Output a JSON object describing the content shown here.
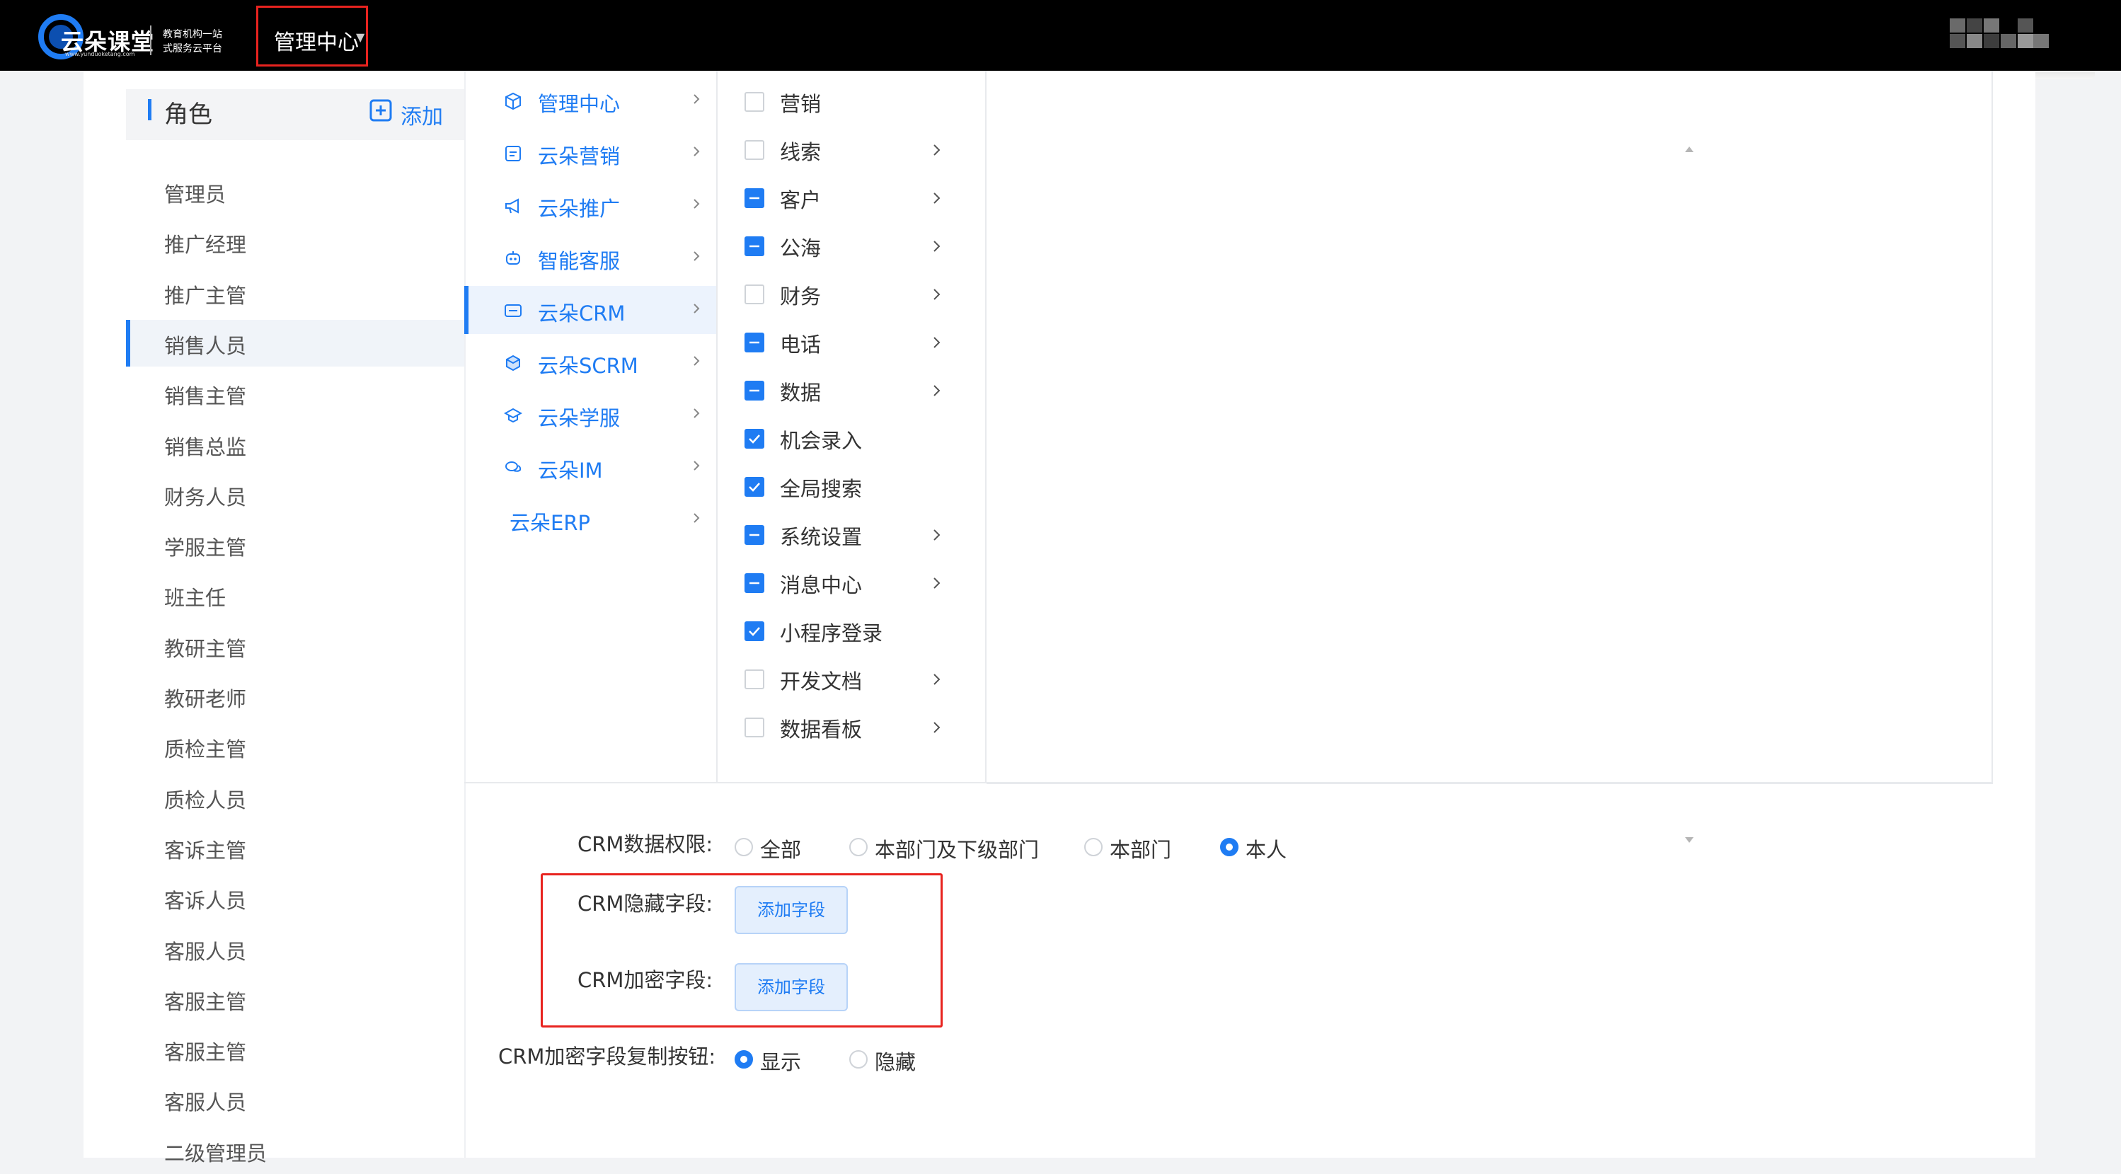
{
  "header": {
    "logo_text": "云朵课堂",
    "logo_url": "www.yunduoketang.com",
    "slogan_line1": "教育机构一站",
    "slogan_line2": "式服务云平台",
    "nav_label": "管理中心"
  },
  "roles_panel": {
    "title": "角色",
    "add_label": "添加",
    "items": [
      "管理员",
      "推广经理",
      "推广主管",
      "销售人员",
      "销售主管",
      "销售总监",
      "财务人员",
      "学服主管",
      "班主任",
      "教研主管",
      "教研老师",
      "质检主管",
      "质检人员",
      "客诉主管",
      "客诉人员",
      "客服人员",
      "客服主管",
      "客服主管",
      "客服人员",
      "二级管理员"
    ],
    "active_index": 3
  },
  "modules": {
    "items": [
      {
        "label": "管理中心",
        "icon": "cube-icon"
      },
      {
        "label": "云朵营销",
        "icon": "marketing-icon"
      },
      {
        "label": "云朵推广",
        "icon": "megaphone-icon"
      },
      {
        "label": "智能客服",
        "icon": "robot-icon"
      },
      {
        "label": "云朵CRM",
        "icon": "crm-icon"
      },
      {
        "label": "云朵SCRM",
        "icon": "scrm-icon"
      },
      {
        "label": "云朵学服",
        "icon": "graduation-cap-icon"
      },
      {
        "label": "云朵IM",
        "icon": "chat-icon"
      },
      {
        "label": "云朵ERP",
        "icon": ""
      }
    ],
    "active_index": 4
  },
  "submenus": {
    "items": [
      {
        "label": "营销",
        "state": "unchecked",
        "has_children": false
      },
      {
        "label": "线索",
        "state": "unchecked",
        "has_children": true
      },
      {
        "label": "客户",
        "state": "partial",
        "has_children": true
      },
      {
        "label": "公海",
        "state": "partial",
        "has_children": true
      },
      {
        "label": "财务",
        "state": "unchecked",
        "has_children": true
      },
      {
        "label": "电话",
        "state": "partial",
        "has_children": true
      },
      {
        "label": "数据",
        "state": "partial",
        "has_children": true
      },
      {
        "label": "机会录入",
        "state": "checked",
        "has_children": false
      },
      {
        "label": "全局搜索",
        "state": "checked",
        "has_children": false
      },
      {
        "label": "系统设置",
        "state": "partial",
        "has_children": true
      },
      {
        "label": "消息中心",
        "state": "partial",
        "has_children": true
      },
      {
        "label": "小程序登录",
        "state": "checked",
        "has_children": false
      },
      {
        "label": "开发文档",
        "state": "unchecked",
        "has_children": true
      },
      {
        "label": "数据看板",
        "state": "unchecked",
        "has_children": true
      }
    ]
  },
  "settings": {
    "data_permission": {
      "label": "CRM数据权限:",
      "options": [
        "全部",
        "本部门及下级部门",
        "本部门",
        "本人"
      ],
      "selected_index": 3
    },
    "hidden_fields": {
      "label": "CRM隐藏字段:",
      "button": "添加字段"
    },
    "encrypted_fields": {
      "label": "CRM加密字段:",
      "button": "添加字段"
    },
    "copy_button": {
      "label": "CRM加密字段复制按钮:",
      "options": [
        "显示",
        "隐藏"
      ],
      "selected_index": 0
    }
  },
  "colors": {
    "accent": "#1f7cf3",
    "highlight": "#e8231f",
    "topbar": "#000000"
  }
}
